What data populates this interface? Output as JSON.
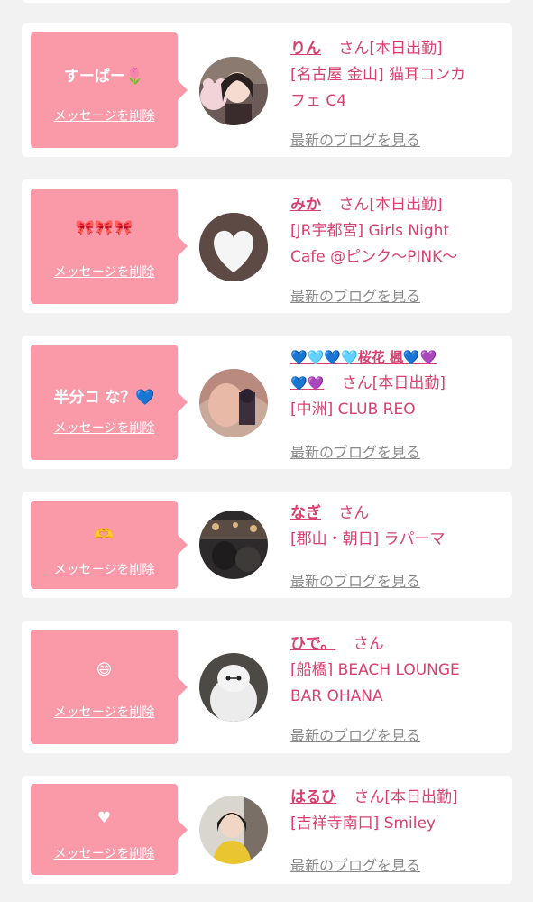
{
  "colors": {
    "page_bg": "#f2f2f2",
    "card_bg": "#ffffff",
    "bubble_bg": "#fa9aa9",
    "accent_pink": "#d8406f",
    "link_gray": "#8a8a8a"
  },
  "entries": [
    {
      "message": "すーぱー🌷",
      "delete_label": "メッセージを削除",
      "name": "りん",
      "honorific": "さん",
      "status": "[本日出勤]",
      "shop_line1": "[名古屋 金山] 猫耳コンカ",
      "shop_line2": "フェ C4",
      "blog_label": "最新のブログを見る"
    },
    {
      "message": "🎀🎀🎀",
      "delete_label": "メッセージを削除",
      "name": "みか",
      "honorific": "さん",
      "status": "[本日出勤]",
      "shop_line1": "[JR宇都宮] Girls Night",
      "shop_line2": "Cafe @ピンク〜PINK〜",
      "blog_label": "最新のブログを見る"
    },
    {
      "message": "半分コ な？💙",
      "delete_label": "メッセージを削除",
      "name_line1": "💙🩵💙🩵桜花 楓💙💜",
      "name_line2": "💙💜",
      "honorific": "さん",
      "status": "[本日出勤]",
      "shop_line1": "[中洲] CLUB REO",
      "blog_label": "最新のブログを見る"
    },
    {
      "message": "🫶",
      "delete_label": "メッセージを削除",
      "name": "なぎ",
      "honorific": "さん",
      "shop_line1": "[郡山・朝日] ラパーマ",
      "blog_label": "最新のブログを見る"
    },
    {
      "message": "😄",
      "delete_label": "メッセージを削除",
      "name": "ひで。",
      "honorific": "さん",
      "shop_line1": "[船橋] BEACH LOUNGE",
      "shop_line2": "BAR OHANA",
      "blog_label": "最新のブログを見る"
    },
    {
      "message": "♥",
      "delete_label": "メッセージを削除",
      "name": "はるひ",
      "honorific": "さん",
      "status": "[本日出勤]",
      "shop_line1": "[吉祥寺南口] Smiley",
      "blog_label": "最新のブログを見る"
    }
  ]
}
